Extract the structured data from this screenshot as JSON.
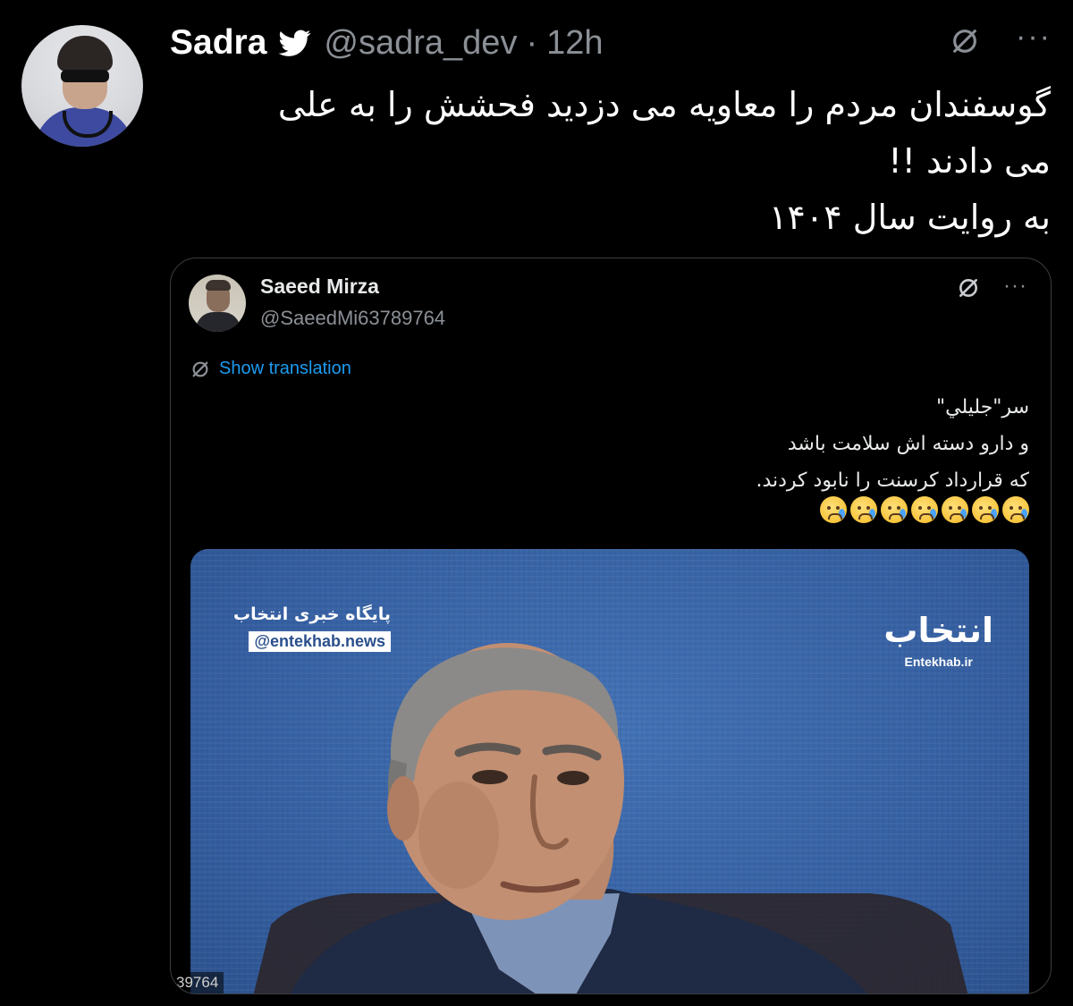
{
  "author": {
    "name": "Sadra",
    "handle": "@sadra_dev",
    "separator": "·",
    "time": "12h"
  },
  "tweet": {
    "lines": [
      "گوسفندان مردم را معاویه می دزدید فحشش را به علی",
      "می دادند !!",
      "به روایت سال ۱۴۰۴"
    ]
  },
  "icons": {
    "verified": "twitter-bird-icon",
    "translate": "translate-icon",
    "more": "more-icon"
  },
  "more_glyph": "···",
  "quoted": {
    "name": "Saeed Mirza",
    "handle": "@SaeedMi63789764",
    "show_translation": "Show translation",
    "lines": [
      "سر\"جليلي\"",
      "و دارو دسته اش سلامت باشد",
      "كه قرارداد كرسنت را نابود كردند."
    ],
    "emoji_count": 7,
    "media": {
      "brand_title": "پایگاه خبری انتخاب",
      "brand_handle": "@entekhab.news",
      "logo_text": "انتخاب",
      "logo_url": "Entekhab.ir",
      "corner_label": "39764"
    }
  },
  "colors": {
    "background": "#000000",
    "link": "#1d9bf0",
    "muted": "#8b9096",
    "news_blue": "#3a64a6"
  }
}
